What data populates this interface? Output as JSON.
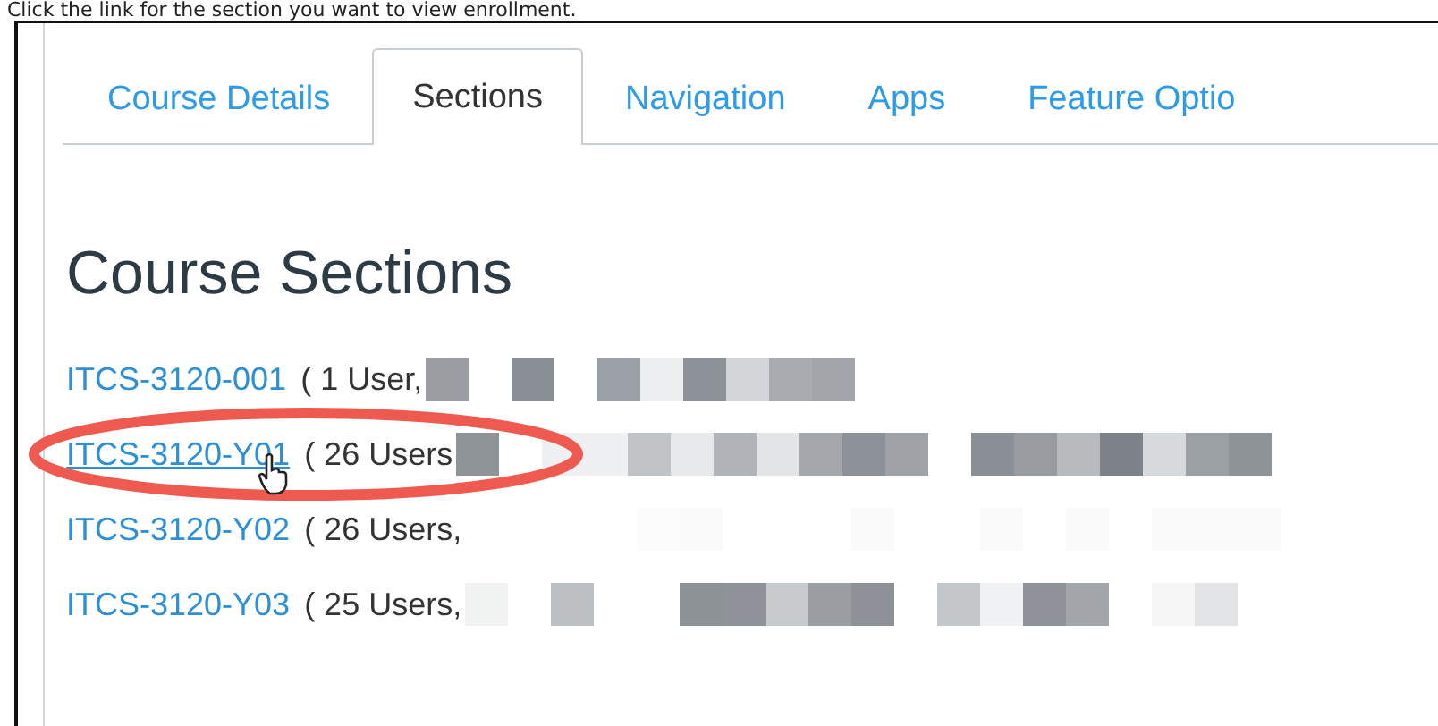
{
  "instruction": "Click the link for the section you want to view enrollment.",
  "tabs": [
    {
      "label": "Course Details",
      "selected": false
    },
    {
      "label": "Sections",
      "selected": true
    },
    {
      "label": "Navigation",
      "selected": false
    },
    {
      "label": "Apps",
      "selected": false
    },
    {
      "label": "Feature Optio",
      "selected": false
    }
  ],
  "heading": "Course Sections",
  "sections": [
    {
      "link": "ITCS-3120-001",
      "users": "( 1 User,",
      "hovered": false,
      "circled": false
    },
    {
      "link": "ITCS-3120-Y01",
      "users": "( 26 Users",
      "hovered": true,
      "circled": true
    },
    {
      "link": "ITCS-3120-Y02",
      "users": "( 26 Users,",
      "hovered": false,
      "circled": false
    },
    {
      "link": "ITCS-3120-Y03",
      "users": "( 25 Users,",
      "hovered": false,
      "circled": false
    }
  ]
}
